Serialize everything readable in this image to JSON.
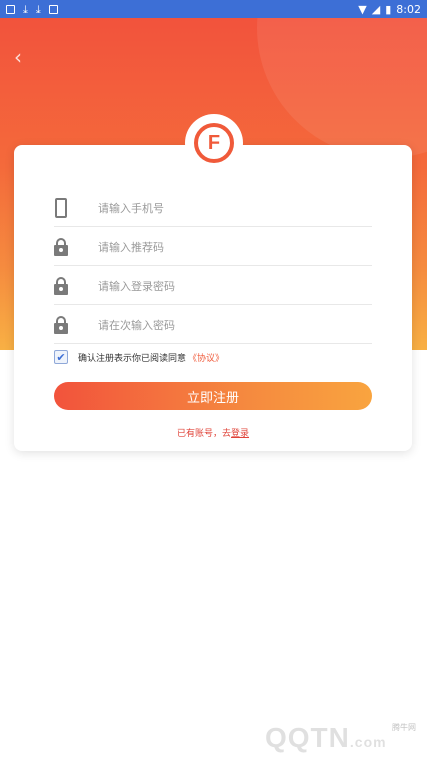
{
  "status_bar": {
    "time": "8:02",
    "left_icons": [
      "notification-icon",
      "download-icon",
      "download-icon",
      "image-icon"
    ],
    "right_icons": [
      "wifi-icon",
      "signal-icon",
      "battery-icon"
    ]
  },
  "header": {
    "back_icon": "chevron-left-icon",
    "logo_letter": "F"
  },
  "form": {
    "phone": {
      "placeholder": "请输入手机号",
      "icon": "phone-icon"
    },
    "referral": {
      "placeholder": "请输入推荐码",
      "icon": "lock-icon"
    },
    "password": {
      "placeholder": "请输入登录密码",
      "icon": "lock-icon"
    },
    "confirm_password": {
      "placeholder": "请在次输入密码",
      "icon": "lock-icon"
    },
    "agree_text": "确认注册表示你已阅读同意",
    "agree_link": "《协议》",
    "agree_checked": true,
    "submit_label": "立即注册",
    "login_prompt": "已有账号，去",
    "login_link": "登录"
  },
  "watermark": {
    "brand": "QQTN",
    "suffix": ".com",
    "label": "腾牛网"
  },
  "colors": {
    "accent": "#f05a3a",
    "gradient_start": "#f2533c",
    "gradient_end": "#f9a43f",
    "status_bar": "#3d6fd6"
  }
}
